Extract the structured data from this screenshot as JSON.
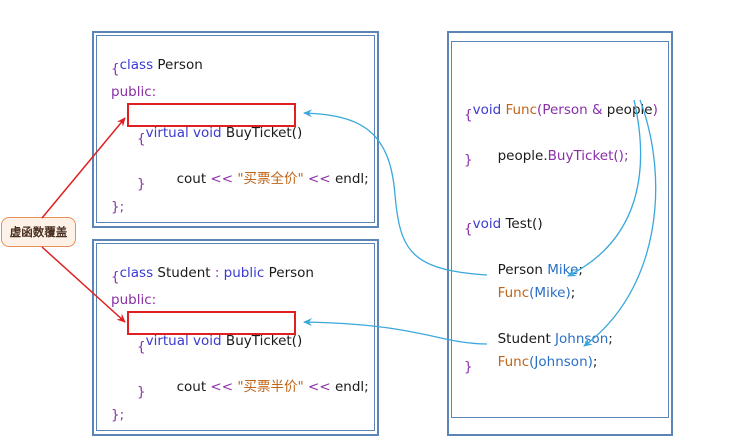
{
  "bubble_label": "虚函数覆盖",
  "person_class": {
    "decl_kw": "class",
    "decl_name": " Person",
    "open_brace": "{",
    "public_kw": "public:",
    "virtual_kw": "virtual",
    "void_kw": " void",
    "method": " BuyTicket()",
    "inner_open": "{",
    "cout": "cout",
    "op1": " <<",
    "string": " \"买票全价\"",
    "op2": " <<",
    "endl": " endl;",
    "inner_close": "}",
    "close": "};"
  },
  "student_class": {
    "decl_kw": "class",
    "decl_name": " Student",
    "colon": " :",
    "public_inherit": " public",
    "base": " Person",
    "open_brace": "{",
    "public_kw": "public:",
    "virtual_kw": "virtual",
    "void_kw": " void",
    "method": " BuyTicket()",
    "inner_open": "{",
    "cout": "cout",
    "op1": " <<",
    "string": " \"买票半价\"",
    "op2": " <<",
    "endl": " endl;",
    "inner_close": "}",
    "close": "};"
  },
  "right_code": {
    "func_void": "void",
    "func_name": " Func",
    "func_params_open": "(",
    "func_param_type": "Person",
    "func_amp": " &",
    "func_param_name": " people",
    "func_params_close": ")",
    "func_open": "{",
    "call_obj": "people.",
    "call_method": "BuyTicket",
    "call_end": "();",
    "func_close": "}",
    "test_void": "void",
    "test_name": " Test()",
    "test_open": "{",
    "mike_type": "Person",
    "mike_name": " Mike",
    "mike_semi": ";",
    "func1_name": "Func",
    "func1_args": "(Mike)",
    "func1_semi": ";",
    "johnson_type": "Student",
    "johnson_name": " Johnson",
    "johnson_semi": ";",
    "func2_name": "Func",
    "func2_args": "(Johnson)",
    "func2_semi": ";",
    "test_close": "}"
  },
  "colors": {
    "box_border": "#5b85b5",
    "highlight_border": "#e02020",
    "arrow_blue": "#3aa8dc",
    "arrow_red": "#e02020",
    "bubble_border": "#e8905a"
  }
}
